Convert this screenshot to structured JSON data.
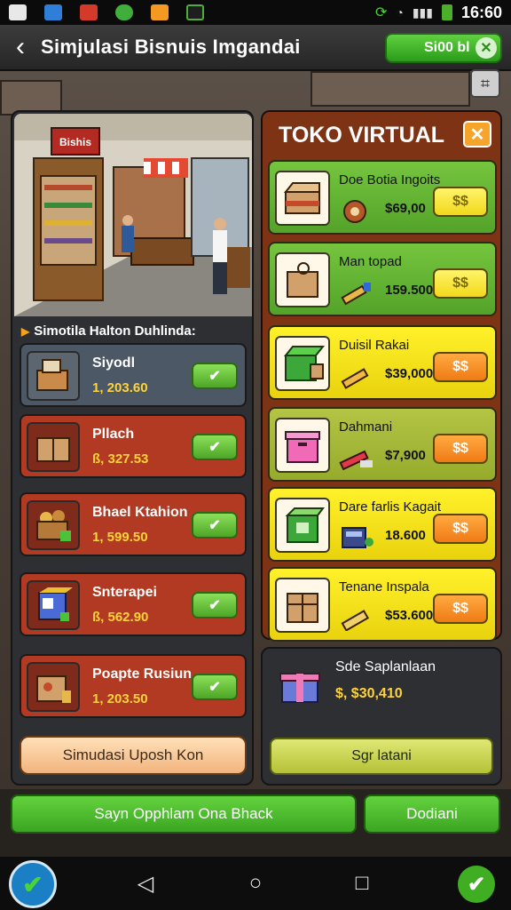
{
  "status_bar": {
    "time": "16:60",
    "icons": [
      "gallery-icon",
      "dropbox-icon",
      "app-red-icon",
      "app-green-icon",
      "app-orange-icon",
      "note-icon"
    ]
  },
  "header": {
    "title": "Simjulasi Bisnuis Imgandai",
    "back_icon": "back-arrow-icon",
    "coin_label": "Si00 bl",
    "coin_close": "✕"
  },
  "map_button": {
    "icon": "map-icon"
  },
  "left_panel": {
    "section_label": "Simotila Halton Duhlinda:",
    "items": [
      {
        "name": "Siyodl",
        "price": "1, 203.60",
        "button": "✔",
        "style": "first"
      },
      {
        "name": "Pllach",
        "price": "ß, 327.53",
        "button": "✔",
        "style": "red"
      },
      {
        "name": "Bhael Ktahion",
        "price": "1, 599.50",
        "button": "✔",
        "style": "red"
      },
      {
        "name": "Snterapei",
        "price": "ß, 562.90",
        "button": "✔",
        "style": "red"
      },
      {
        "name": "Poapte Rusiun",
        "price": "1, 203.50",
        "button": "✔",
        "style": "red"
      }
    ],
    "sim_button": "Simudasi Uposh Kon",
    "scene_sign": "Bishis"
  },
  "shop": {
    "title": "TOKO VIRTUAL",
    "close": "✕",
    "items": [
      {
        "name": "Doe Botia Ingoits",
        "price": "$69,00",
        "button": "$$",
        "style": "green",
        "btn": "y"
      },
      {
        "name": "Man topad",
        "price": "159.500",
        "button": "$$",
        "style": "green",
        "btn": "y"
      },
      {
        "name": "Duisil Rakai",
        "price": "$39,000",
        "button": "$$",
        "style": "yellow",
        "btn": "o"
      },
      {
        "name": "Dahmani",
        "price": "$7,900",
        "button": "$$",
        "style": "olive",
        "btn": "o"
      },
      {
        "name": "Dare farlis Kagait",
        "price": "18.600",
        "button": "$$",
        "style": "yellow",
        "btn": "o"
      },
      {
        "name": "Tenane Inspala",
        "price": "$53.600",
        "button": "$$",
        "style": "yellow",
        "btn": "o"
      }
    ]
  },
  "summary": {
    "title": "Sde Saplanlaan",
    "value": "$, $30,410",
    "button": "Sgr latani"
  },
  "action_bar": {
    "main_button": "Sayn Opphlam Ona Bhack",
    "side_button": "Dodiani"
  },
  "nav": {
    "back": "◁",
    "home": "○",
    "recent": "□",
    "left_badge": "✔",
    "right_badge": "✔"
  }
}
